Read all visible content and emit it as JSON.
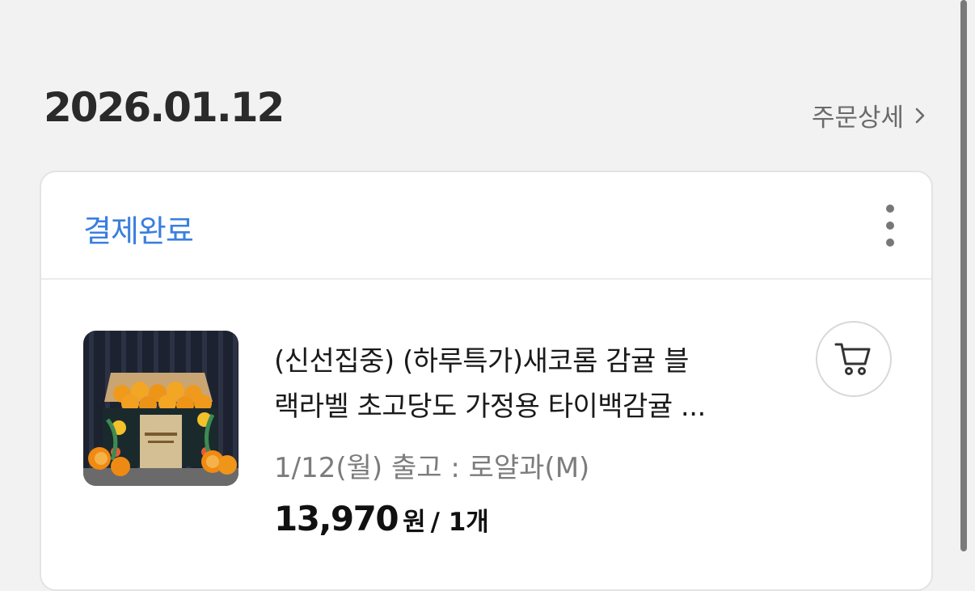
{
  "order": {
    "date": "2026.01.12",
    "detail_label": "주문상세",
    "status": "결제완료"
  },
  "item": {
    "title_line1": "(신선집중) (하루특가)새코롬 감귤 블",
    "title_line2": "랙라벨 초고당도 가정용 타이백감귤 ...",
    "shipping": "1/12(월) 출고 : 로얄과(M)",
    "price": "13,970",
    "currency": "원",
    "quantity": "/ 1개",
    "image": "citrus-box-product-photo"
  },
  "icons": {
    "chevron": "chevron-right-icon",
    "more": "more-vertical-icon",
    "cart": "cart-icon"
  },
  "colors": {
    "status": "#3a7fe0",
    "background": "#f2f2f2"
  }
}
